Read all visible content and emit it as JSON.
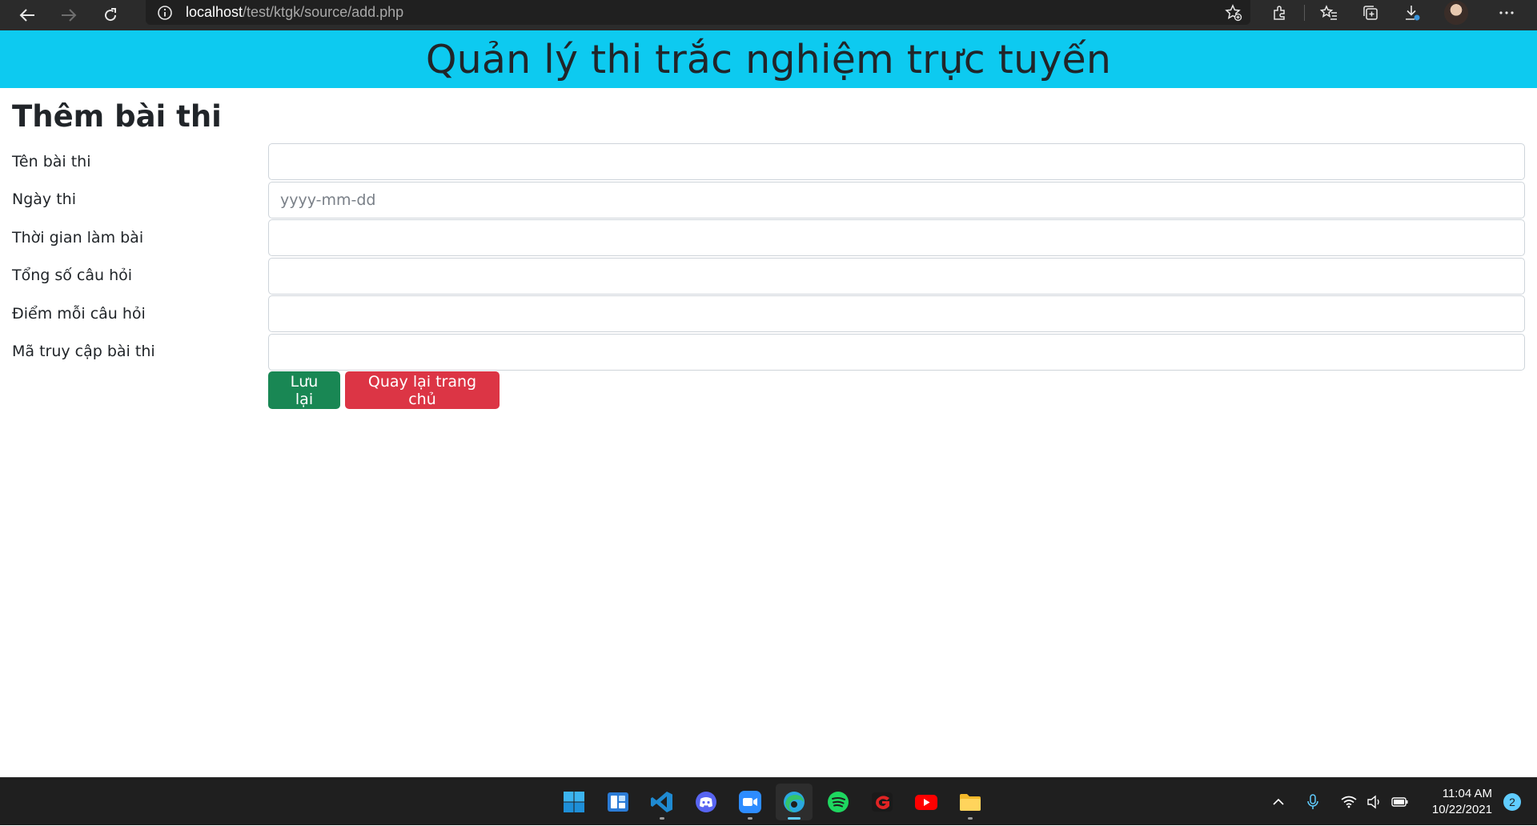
{
  "browser": {
    "url_host": "localhost",
    "url_path": "/test/ktgk/source/add.php"
  },
  "header": {
    "title": "Quản lý thi trắc nghiệm trực tuyến",
    "background": "#0dcaf0"
  },
  "form": {
    "section_title": "Thêm bài thi",
    "fields": [
      {
        "label": "Tên bài thi",
        "value": "",
        "placeholder": ""
      },
      {
        "label": "Ngày thi",
        "value": "",
        "placeholder": "yyyy-mm-dd"
      },
      {
        "label": "Thời gian làm bài",
        "value": "",
        "placeholder": ""
      },
      {
        "label": "Tổng số câu hỏi",
        "value": "",
        "placeholder": ""
      },
      {
        "label": "Điểm mỗi câu hỏi",
        "value": "",
        "placeholder": ""
      },
      {
        "label": "Mã truy cập bài thi",
        "value": "",
        "placeholder": ""
      }
    ],
    "save_label": "Lưu lại",
    "back_label": "Quay lại trang chủ",
    "save_color": "#198754",
    "back_color": "#dc3545"
  },
  "taskbar": {
    "apps": [
      "windows-start",
      "widgets",
      "vscode",
      "discord",
      "zoom",
      "edge",
      "spotify",
      "garena",
      "youtube",
      "file-explorer"
    ],
    "active_app": "edge",
    "time": "11:04 AM",
    "date": "10/22/2021",
    "notification_count": "2"
  }
}
